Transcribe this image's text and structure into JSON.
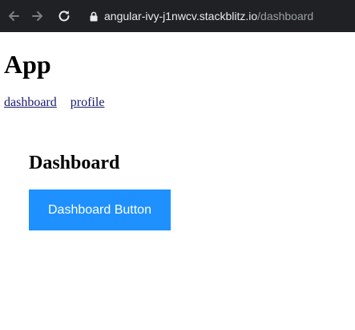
{
  "browser": {
    "url_host": "angular-ivy-j1nwcv.stackblitz.io",
    "url_path": "/dashboard",
    "icons": {
      "back": "arrow-left-icon",
      "forward": "arrow-right-icon",
      "reload": "reload-icon",
      "secure": "lock-icon"
    }
  },
  "app": {
    "title": "App",
    "nav": {
      "dashboard_label": "dashboard",
      "profile_label": "profile"
    }
  },
  "dashboard": {
    "heading": "Dashboard",
    "button_label": "Dashboard Button",
    "button_color": "#1e90ff"
  },
  "colors": {
    "toolbar_bg": "#202124",
    "url_host": "#e8eaed",
    "url_path": "#9aa0a6"
  }
}
